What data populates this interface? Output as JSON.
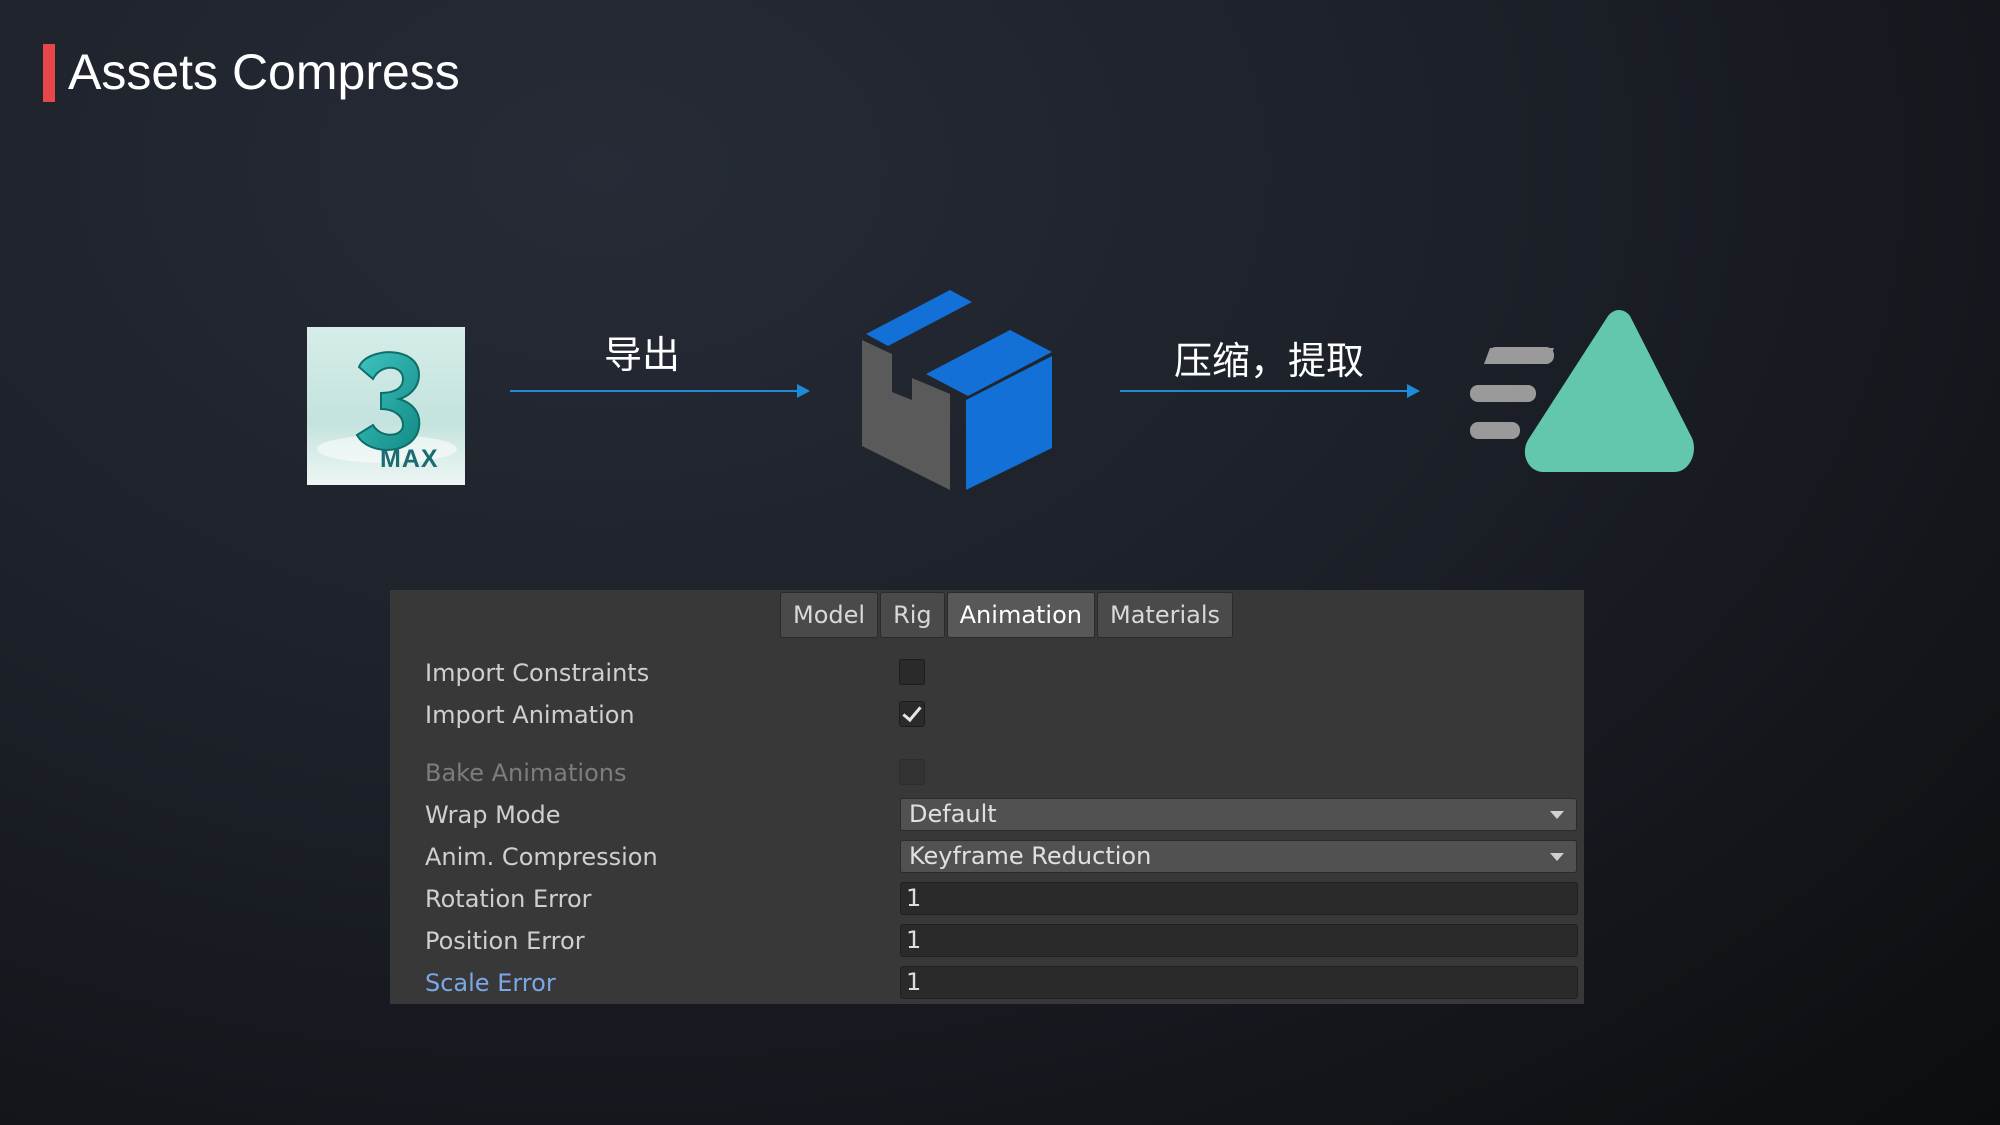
{
  "slide": {
    "title": "Assets Compress",
    "accent_color": "#e8474a"
  },
  "pipeline": {
    "source_icon": "3ds-max-logo-icon",
    "source_logo_text": "MAX",
    "step1_label": "导出",
    "middle_icon": "unity-logo-icon",
    "step2_label": "压缩，提取",
    "target_icon": "ktx-triangle-logo-icon",
    "arrow_color": "#1f8ad6",
    "target_color": "#62c7ad"
  },
  "inspector": {
    "tabs": [
      {
        "label": "Model",
        "active": false
      },
      {
        "label": "Rig",
        "active": false
      },
      {
        "label": "Animation",
        "active": true
      },
      {
        "label": "Materials",
        "active": false
      }
    ],
    "import_constraints": {
      "label": "Import Constraints",
      "checked": false
    },
    "import_animation": {
      "label": "Import Animation",
      "checked": true
    },
    "bake_animations": {
      "label": "Bake Animations",
      "checked": false,
      "disabled": true
    },
    "wrap_mode": {
      "label": "Wrap Mode",
      "value": "Default"
    },
    "anim_compression": {
      "label": "Anim. Compression",
      "value": "Keyframe Reduction"
    },
    "rotation_error": {
      "label": "Rotation Error",
      "value": "1"
    },
    "position_error": {
      "label": "Position Error",
      "value": "1"
    },
    "scale_error": {
      "label": "Scale Error",
      "value": "1"
    }
  }
}
